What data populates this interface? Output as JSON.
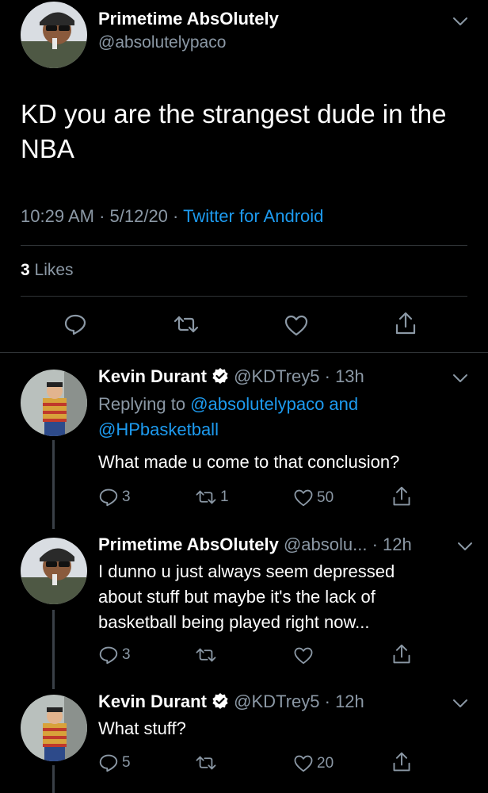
{
  "main_tweet": {
    "author_name": "Primetime AbsOlutely",
    "author_handle": "@absolutelypaco",
    "text": "KD you are the strangest dude in the NBA",
    "time": "10:29 AM",
    "sep1": " · ",
    "date": "5/12/20",
    "sep2": " · ",
    "client": "Twitter for Android",
    "likes_count": "3",
    "likes_label": "Likes"
  },
  "replies": [
    {
      "author_name": "Kevin Durant",
      "author_handle": "@KDTrey5",
      "age": "· 13h",
      "replying_prefix": "Replying to",
      "replying_users": "@absolutelypaco and",
      "replying_users2": "@HPbasketball",
      "text": "What made u come to that conclusion?",
      "replies": "3",
      "retweets": "1",
      "likes": "50"
    },
    {
      "author_name": "Primetime AbsOlutely",
      "author_handle": "@absolu...",
      "age": "· 12h",
      "text_line1": "I dunno u just always seem depressed",
      "text_line2": "about stuff but maybe it's the lack of",
      "text_line3": "basketball being played right now...",
      "replies": "3",
      "retweets": "",
      "likes": ""
    },
    {
      "author_name": "Kevin Durant",
      "author_handle": "@KDTrey5",
      "age": "· 12h",
      "text": "What stuff?",
      "replies": "5",
      "retweets": "",
      "likes": "20"
    }
  ],
  "colors": {
    "background": "#000000",
    "link": "#1d9bf0",
    "muted": "#8b98a5",
    "verified": "#ffffff"
  },
  "icons": [
    "chevron-down-icon",
    "reply-icon",
    "retweet-icon",
    "like-icon",
    "share-icon",
    "verified-badge-icon"
  ]
}
